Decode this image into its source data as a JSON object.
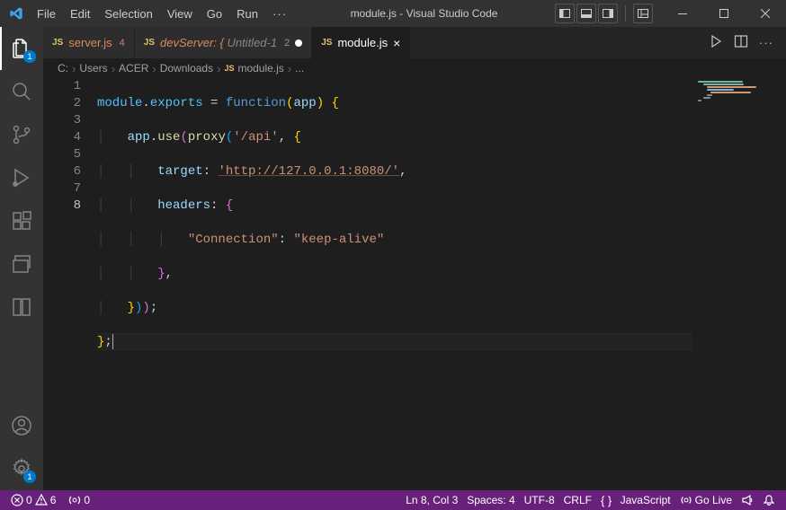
{
  "menubar": {
    "items": [
      "File",
      "Edit",
      "Selection",
      "View",
      "Go",
      "Run"
    ],
    "overflow": "···"
  },
  "title": "module.js - Visual Studio Code",
  "activity": {
    "explorer_badge": "1",
    "settings_badge": "1"
  },
  "tabs": [
    {
      "icon": "JS",
      "label": "server.js",
      "badge": "4",
      "err": true,
      "dirty": false
    },
    {
      "icon": "JS",
      "label1": "devServer: {",
      "label2": "Untitled-1",
      "badge": "2",
      "italic": true,
      "dirty": true,
      "err": true
    },
    {
      "icon": "JS",
      "label": "module.js",
      "active": true
    }
  ],
  "breadcrumbs": [
    "C:",
    "Users",
    "ACER",
    "Downloads",
    "module.js",
    "..."
  ],
  "code": {
    "lines": [
      {
        "raw": "module.exports = function(app) {"
      },
      {
        "raw": "    app.use(proxy('/api', {"
      },
      {
        "raw": "        target: 'http://127.0.0.1:8080/',"
      },
      {
        "raw": "        headers: {"
      },
      {
        "raw": "            \"Connection\": \"keep-alive\""
      },
      {
        "raw": "        },"
      },
      {
        "raw": "    }));"
      },
      {
        "raw": "};"
      }
    ],
    "cursor_line": 8
  },
  "status": {
    "errors": "0",
    "warnings": "6",
    "ports": "0",
    "cursor": "Ln 8, Col 3",
    "spaces": "Spaces: 4",
    "encoding": "UTF-8",
    "eol": "CRLF",
    "lang": "JavaScript",
    "golive": "Go Live"
  }
}
